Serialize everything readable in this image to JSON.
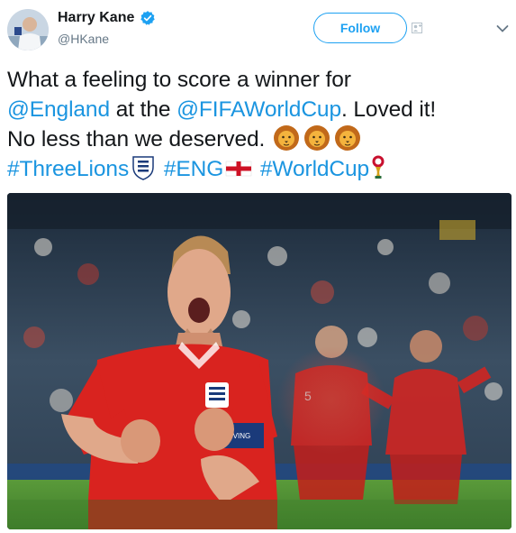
{
  "author": {
    "display_name": "Harry Kane",
    "handle": "@HKane",
    "verified": true,
    "avatar_icon": "profile-avatar"
  },
  "actions": {
    "follow_label": "Follow",
    "follow_icon": "person-add-icon",
    "menu_icon": "chevron-down-icon"
  },
  "tweet": {
    "line1": "What a feeling to score a winner for",
    "mention_england": "@England",
    "text_at_the": " at the ",
    "mention_fifa": "@FIFAWorldCup",
    "text_loved": ". Loved it!",
    "text_deserved": "No less than we deserved. ",
    "hashtag_threelions": "#ThreeLions",
    "hashtag_eng": "#ENG",
    "hashtag_worldcup": "#WorldCup",
    "emojis": [
      "lion-face",
      "lion-face",
      "lion-face",
      "three-lions-crest",
      "england-flag",
      "world-cup-trophy"
    ]
  },
  "colors": {
    "link": "#1b95e0",
    "follow": "#1da1f2",
    "verified": "#1da1f2",
    "kit_red": "#d9231f"
  },
  "media": {
    "type": "photo",
    "description_icon": "goal-celebration-photo"
  }
}
